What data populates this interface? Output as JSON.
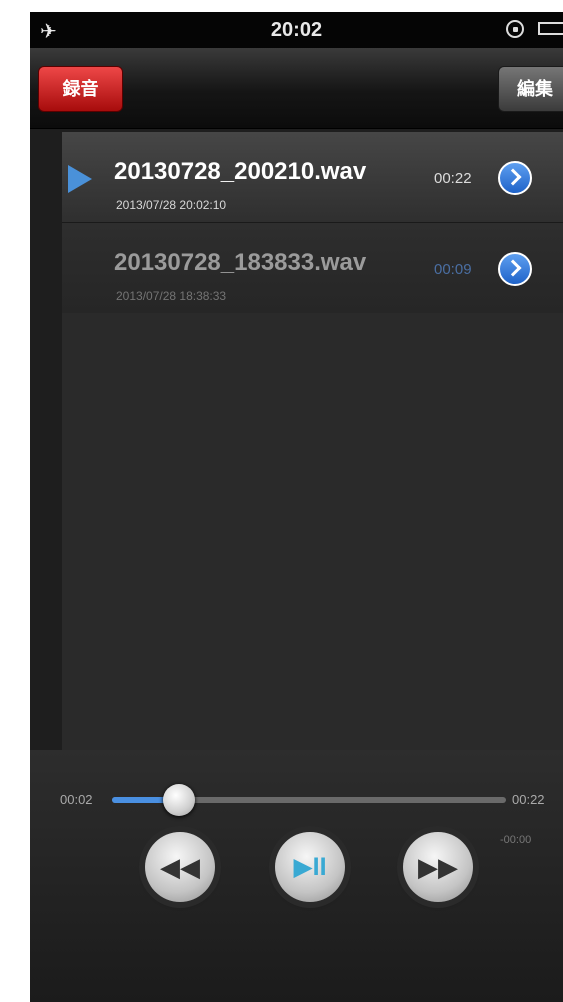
{
  "status_bar": {
    "time": "20:02",
    "airplane_icon": "airplane-icon",
    "rotation_lock_icon": "rotation-lock-icon",
    "battery_icon": "battery-icon"
  },
  "nav": {
    "record_label": "録音",
    "edit_label": "編集"
  },
  "recordings": [
    {
      "name": "20130728_200210.wav",
      "date": "2013/07/28 20:02:10",
      "duration": "00:22",
      "playing": true
    },
    {
      "name": "20130728_183833.wav",
      "date": "2013/07/28 18:38:33",
      "duration": "00:09",
      "playing": false
    }
  ],
  "player": {
    "elapsed": "00:02",
    "total": "00:22",
    "remaining": "-00:00",
    "progress": 0.17,
    "rewind_glyph": "◀◀",
    "playpause_glyph": "▶II",
    "forward_glyph": "▶▶"
  },
  "colors": {
    "record_button": "#c8171b",
    "accent_blue": "#4a91d9",
    "background": "#1e1e1e"
  }
}
